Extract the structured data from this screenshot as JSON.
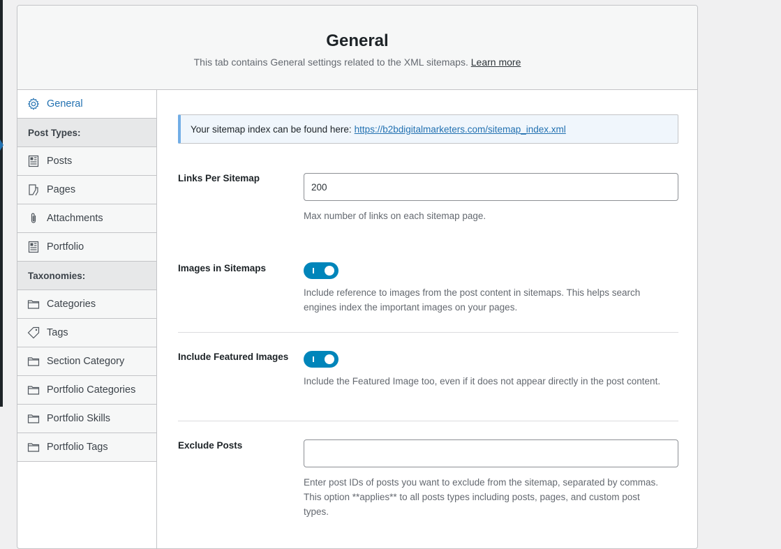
{
  "header": {
    "title": "General",
    "description": "This tab contains General settings related to the XML sitemaps.",
    "learn_more": "Learn more"
  },
  "sidebar": {
    "active": {
      "label": "General",
      "icon": "gear-icon"
    },
    "post_types_heading": "Post Types:",
    "post_types": [
      {
        "label": "Posts",
        "icon": "document-icon"
      },
      {
        "label": "Pages",
        "icon": "page-icon"
      },
      {
        "label": "Attachments",
        "icon": "paperclip-icon"
      },
      {
        "label": "Portfolio",
        "icon": "document-icon"
      }
    ],
    "taxonomies_heading": "Taxonomies:",
    "taxonomies": [
      {
        "label": "Categories",
        "icon": "folder-icon"
      },
      {
        "label": "Tags",
        "icon": "tag-icon"
      },
      {
        "label": "Section Category",
        "icon": "folder-icon"
      },
      {
        "label": "Portfolio Categories",
        "icon": "folder-icon"
      },
      {
        "label": "Portfolio Skills",
        "icon": "folder-icon"
      },
      {
        "label": "Portfolio Tags",
        "icon": "folder-icon"
      }
    ]
  },
  "notice": {
    "text": "Your sitemap index can be found here:",
    "link": "https://b2bdigitalmarketers.com/sitemap_index.xml"
  },
  "settings": {
    "links_per_sitemap": {
      "label": "Links Per Sitemap",
      "value": "200",
      "help": "Max number of links on each sitemap page."
    },
    "images_in_sitemaps": {
      "label": "Images in Sitemaps",
      "enabled": true,
      "help": "Include reference to images from the post content in sitemaps. This helps search engines index the important images on your pages."
    },
    "include_featured_images": {
      "label": "Include Featured Images",
      "enabled": true,
      "help": "Include the Featured Image too, even if it does not appear directly in the post content."
    },
    "exclude_posts": {
      "label": "Exclude Posts",
      "value": "",
      "help": "Enter post IDs of posts you want to exclude from the sitemap, separated by commas. This option **applies** to all posts types including posts, pages, and custom post types."
    }
  },
  "colors": {
    "accent": "#2271b1",
    "toggle_on": "#0085ba",
    "notice_border": "#72aee6"
  }
}
